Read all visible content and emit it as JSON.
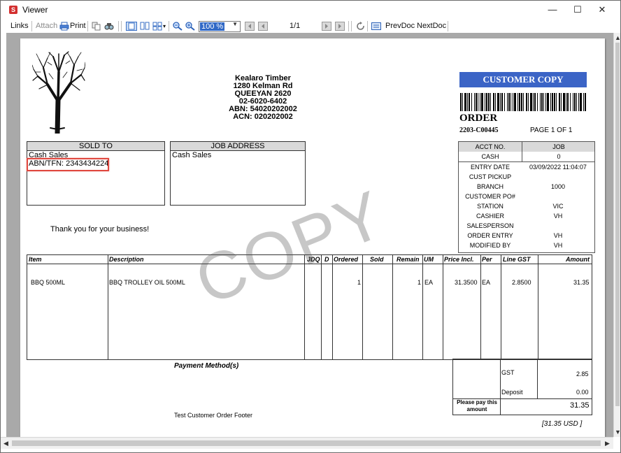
{
  "window": {
    "title": "Viewer",
    "app_icon_letter": "S",
    "minimize": "—",
    "maximize": "☐",
    "close": "✕"
  },
  "toolbar": {
    "links": "Links",
    "attach": "Attach",
    "print": "Print",
    "zoom": "100 %",
    "page_counter": "1/1",
    "prev_doc": "PrevDoc",
    "next_doc": "NextDoc"
  },
  "document": {
    "company": {
      "name": "Kealaro Timber",
      "address1": "1280 Kelman Rd",
      "address2": "QUEEYAN 2620",
      "phone": "02-6020-6402",
      "abn": "ABN: 54020202002",
      "acn": "ACN: 020202002"
    },
    "banner": "CUSTOMER COPY",
    "order_title": "ORDER",
    "order_number": "2203-C00445",
    "page_label": "PAGE  1  OF  1",
    "sold_to": {
      "header": "SOLD TO",
      "name": "Cash Sales",
      "abn": "ABN/TFN: 2343434224"
    },
    "job_address": {
      "header": "JOB ADDRESS",
      "name": "Cash Sales"
    },
    "info": {
      "acct_no_label": "ACCT NO.",
      "job_label": "JOB",
      "acct_no": "CASH",
      "job": "0",
      "entry_date_label": "ENTRY DATE",
      "entry_date": "03/09/2022 11:04:07",
      "cust_pickup": "CUST PICKUP",
      "branch_label": "BRANCH",
      "branch": "1000",
      "customer_po_label": "CUSTOMER PO#",
      "station_label": "STATION",
      "station": "VIC",
      "cashier_label": "CASHIER",
      "cashier": "VH",
      "salesperson_label": "SALESPERSON",
      "order_entry_label": "ORDER ENTRY",
      "order_entry": "VH",
      "modified_by_label": "MODIFIED BY",
      "modified_by": "VH"
    },
    "thanks": "Thank you for your business!",
    "columns": {
      "item": "Item",
      "description": "Description",
      "jdq": "JDQ",
      "d": "D",
      "ordered": "Ordered",
      "sold": "Sold",
      "remain": "Remain",
      "um": "UM",
      "price": "Price Incl.",
      "per": "Per",
      "line_gst": "Line GST",
      "amount": "Amount"
    },
    "line": {
      "item": "BBQ 500ML",
      "description": "BBQ TROLLEY OIL 500ML",
      "ordered": "1",
      "remain": "1",
      "um": "EA",
      "price": "31.3500",
      "per": "EA",
      "line_gst": "2.8500",
      "amount": "31.35"
    },
    "payment_method": "Payment Method(s)",
    "footer": "Test Customer Order Footer",
    "totals": {
      "gst_label": "GST",
      "gst": "2.85",
      "deposit_label": "Deposit",
      "deposit": "0.00",
      "pay_label_1": "Please pay this",
      "pay_label_2": "amount",
      "pay_amount": "31.35",
      "usd": "[31.35 USD ]"
    },
    "watermark": "COPY"
  }
}
